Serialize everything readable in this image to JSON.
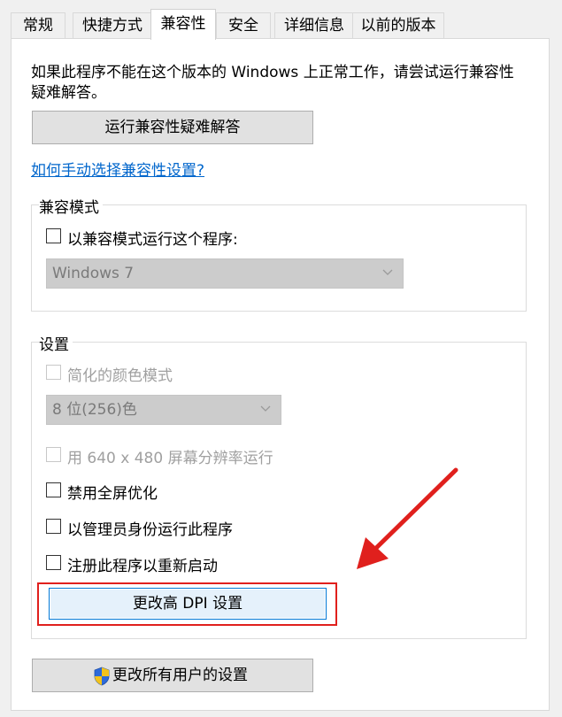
{
  "tabs": [
    {
      "label": "常规",
      "active": false
    },
    {
      "label": "快捷方式",
      "active": false
    },
    {
      "label": "兼容性",
      "active": true
    },
    {
      "label": "安全",
      "active": false
    },
    {
      "label": "详细信息",
      "active": false
    },
    {
      "label": "以前的版本",
      "active": false
    }
  ],
  "intro": {
    "line1": "如果此程序不能在这个版本的 Windows 上正常工作，请尝试运行兼容性",
    "line2": "疑难解答。"
  },
  "troubleshooter_button": "运行兼容性疑难解答",
  "manual_link": "如何手动选择兼容性设置?",
  "compat_mode": {
    "title": "兼容模式",
    "checkbox_label": "以兼容模式运行这个程序:",
    "os_select_value": "Windows 7"
  },
  "settings": {
    "title": "设置",
    "reduced_color": "简化的颜色模式",
    "color_select_value": "8 位(256)色",
    "run_640": "用 640 x 480 屏幕分辨率运行",
    "disable_fullscreen": "禁用全屏优化",
    "run_as_admin": "以管理员身份运行此程序",
    "register_restart": "注册此程序以重新启动",
    "change_dpi_button": "更改高 DPI 设置"
  },
  "all_users_button": "更改所有用户的设置",
  "colors": {
    "highlight": "#e0201d",
    "link": "#0066cc",
    "focus": "#0078d7"
  }
}
